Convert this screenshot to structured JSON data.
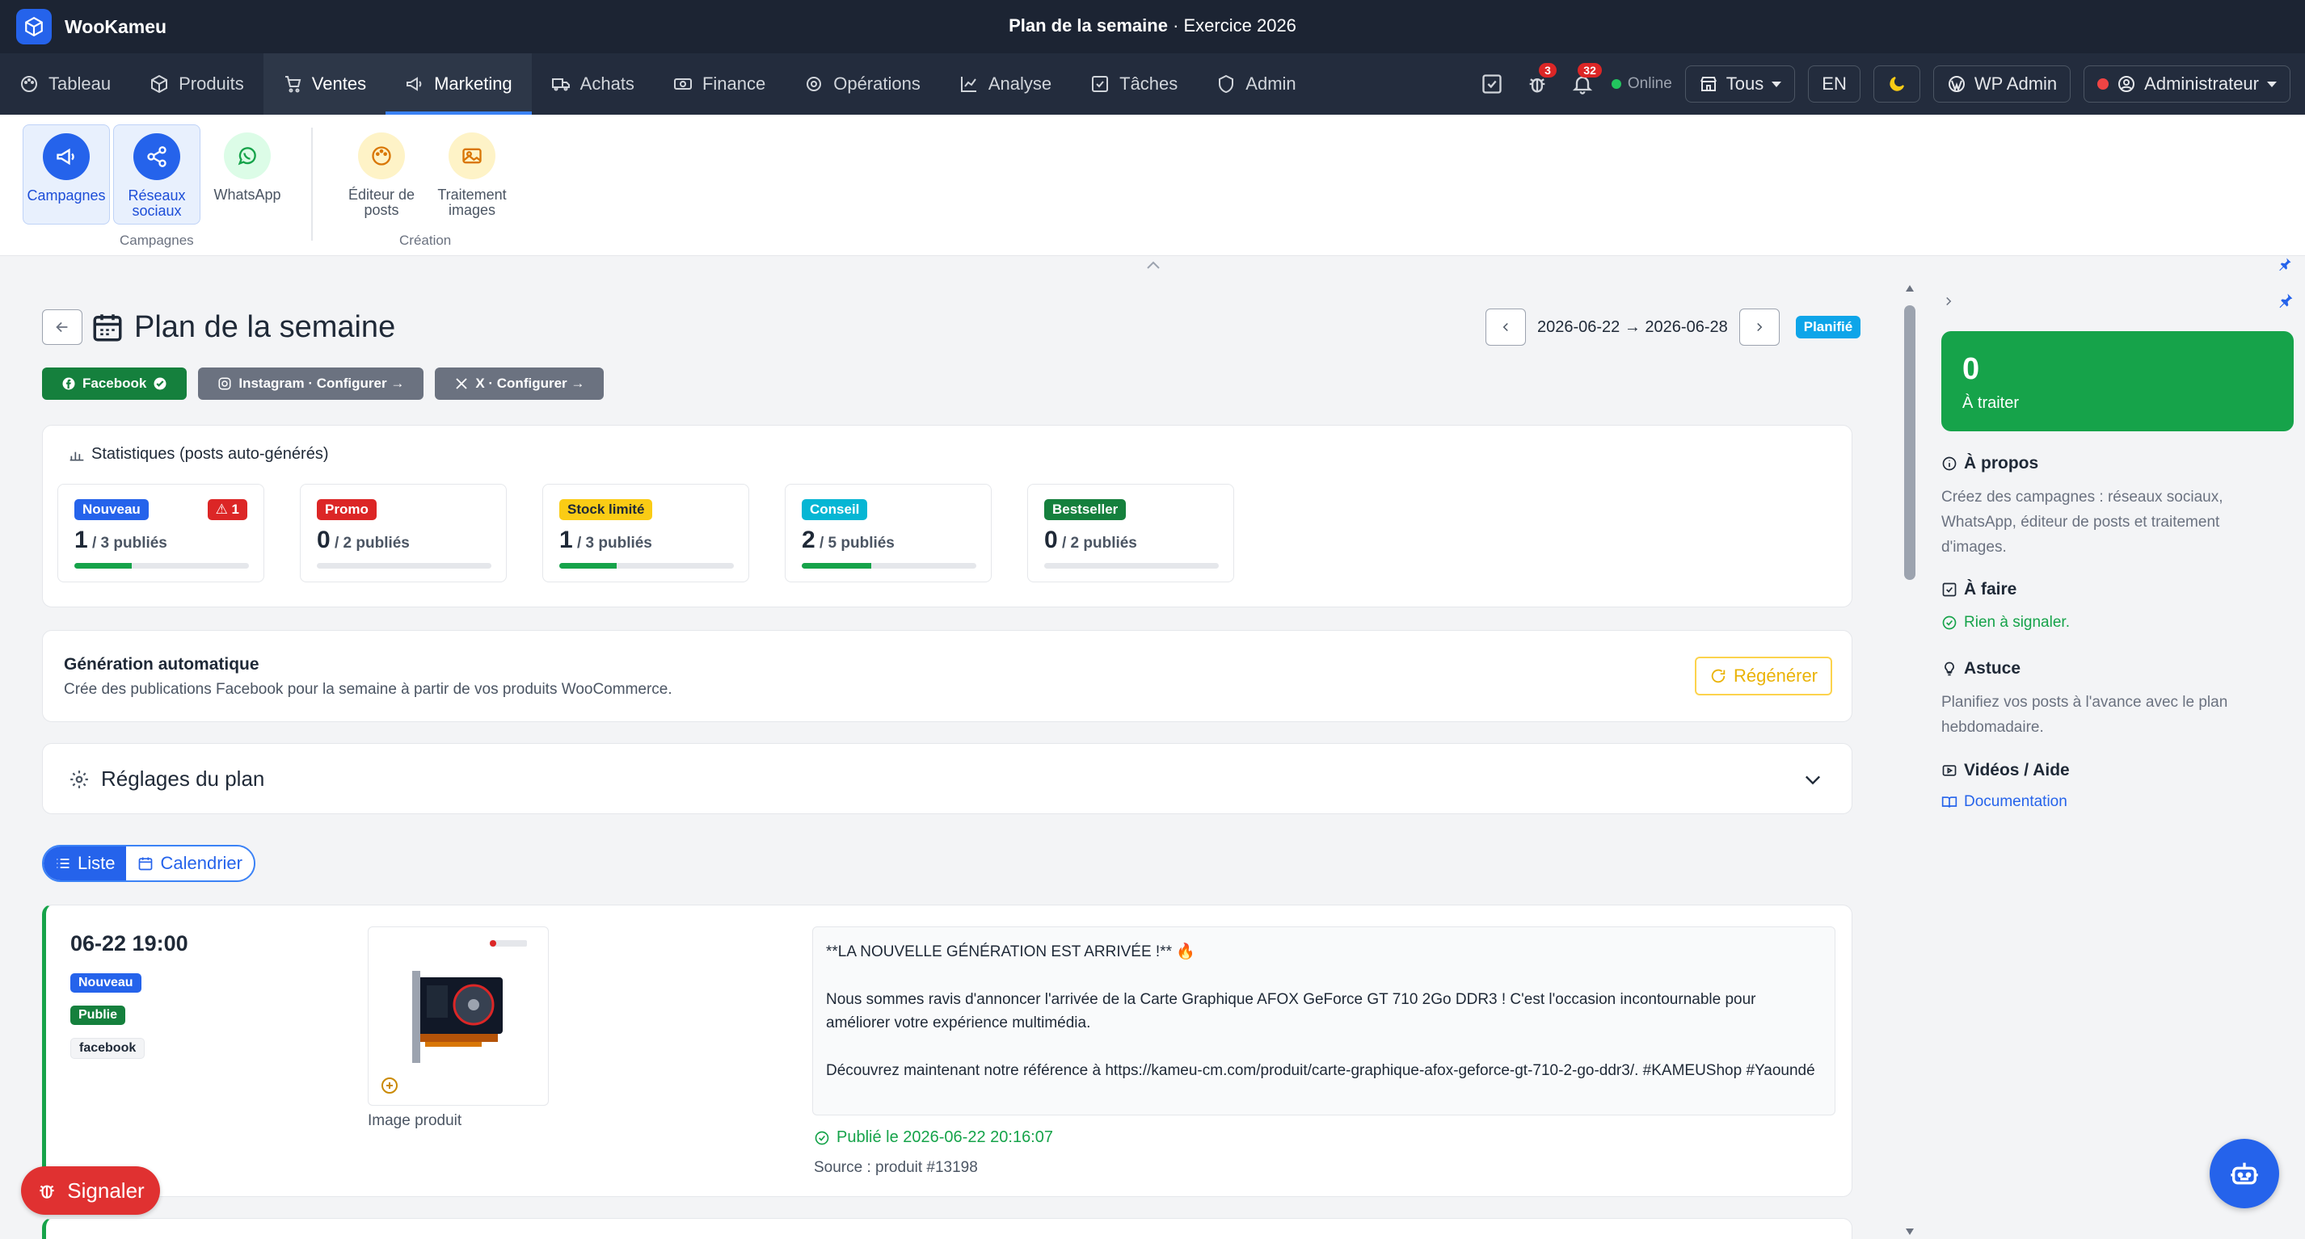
{
  "app": {
    "name": "WooKameu"
  },
  "header": {
    "title": "Plan de la semaine",
    "subtitle": " · Exercice 2026"
  },
  "nav": {
    "items": [
      {
        "label": "Tableau",
        "icon": "palette-icon"
      },
      {
        "label": "Produits",
        "icon": "box-icon"
      },
      {
        "label": "Ventes",
        "icon": "cart-icon"
      },
      {
        "label": "Marketing",
        "icon": "megaphone-icon"
      },
      {
        "label": "Achats",
        "icon": "truck-icon"
      },
      {
        "label": "Finance",
        "icon": "money-icon"
      },
      {
        "label": "Opérations",
        "icon": "gear-icon"
      },
      {
        "label": "Analyse",
        "icon": "chart-icon"
      },
      {
        "label": "Tâches",
        "icon": "check-square-icon"
      },
      {
        "label": "Admin",
        "icon": "shield-icon"
      }
    ],
    "bug_count": "3",
    "notif_count": "32",
    "online_label": "Online",
    "store_select": "Tous",
    "lang": "EN",
    "wp_admin": "WP Admin",
    "user": "Administrateur"
  },
  "ribbon": {
    "group1_label": "Campagnes",
    "group2_label": "Création",
    "items": [
      {
        "label": "Campagnes",
        "icon": "megaphone-icon"
      },
      {
        "label": "Réseaux sociaux",
        "icon": "share-icon"
      },
      {
        "label": "WhatsApp",
        "icon": "whatsapp-icon"
      },
      {
        "label": "Éditeur de posts",
        "icon": "palette-icon"
      },
      {
        "label": "Traitement images",
        "icon": "image-icon"
      }
    ]
  },
  "page": {
    "title": "Plan de la semaine",
    "date_range": "2026-06-22 → 2026-06-28",
    "status": "Planifié",
    "networks": [
      {
        "label": "Facebook",
        "color": "#15803d"
      },
      {
        "label": "Instagram · Configurer →",
        "color": "#6b7280"
      },
      {
        "label": "X · Configurer →",
        "color": "#6b7280"
      }
    ]
  },
  "stats": {
    "title": "Statistiques (posts auto-générés)",
    "items": [
      {
        "tag": "Nouveau",
        "color": "#2563eb",
        "value": "1",
        "sub": " / 3 publiés",
        "progress": 0.33,
        "alert": "1"
      },
      {
        "tag": "Promo",
        "color": "#dc2626",
        "value": "0",
        "sub": " / 2 publiés",
        "progress": 0
      },
      {
        "tag": "Stock limité",
        "color": "#facc15",
        "text_color": "#1f2937",
        "value": "1",
        "sub": " / 3 publiés",
        "progress": 0.33
      },
      {
        "tag": "Conseil",
        "color": "#06b6d4",
        "value": "2",
        "sub": " / 5 publiés",
        "progress": 0.4
      },
      {
        "tag": "Bestseller",
        "color": "#15803d",
        "value": "0",
        "sub": " / 2 publiés",
        "progress": 0
      }
    ]
  },
  "generation": {
    "title": "Génération automatique",
    "desc": "Crée des publications Facebook pour la semaine à partir de vos produits WooCommerce.",
    "button": "Régénérer"
  },
  "settings": {
    "title": "Réglages du plan"
  },
  "view": {
    "list": "Liste",
    "calendar": "Calendrier"
  },
  "post": {
    "time": "06-22 19:00",
    "tag_type": "Nouveau",
    "tag_status": "Publie",
    "tag_network": "facebook",
    "image_caption": "Image produit",
    "text_p1": "**LA NOUVELLE GÉNÉRATION EST ARRIVÉE !** 🔥",
    "text_p2": "Nous sommes ravis d'annoncer l'arrivée de la Carte Graphique AFOX GeForce GT 710 2Go DDR3 ! C'est l'occasion incontournable pour améliorer votre expérience multimédia.",
    "text_p3": "Découvrez maintenant notre référence à https://kameu-cm.com/produit/carte-graphique-afox-geforce-gt-710-2-go-ddr3/. #KAMEUShop #Yaoundé",
    "published": "Publié le 2026-06-22 20:16:07",
    "source": "Source : produit #13198"
  },
  "rpanel": {
    "todo_count": "0",
    "todo_label": "À traiter",
    "about_title": "À propos",
    "about_text": "Créez des campagnes : réseaux sociaux, WhatsApp, éditeur de posts et traitement d'images.",
    "todo_title": "À faire",
    "todo_ok": "Rien à signaler.",
    "tip_title": "Astuce",
    "tip_text": "Planifiez vos posts à l'avance avec le plan hebdomadaire.",
    "videos_title": "Vidéos / Aide",
    "doc_link": "Documentation"
  },
  "floating": {
    "signal": "Signaler"
  }
}
